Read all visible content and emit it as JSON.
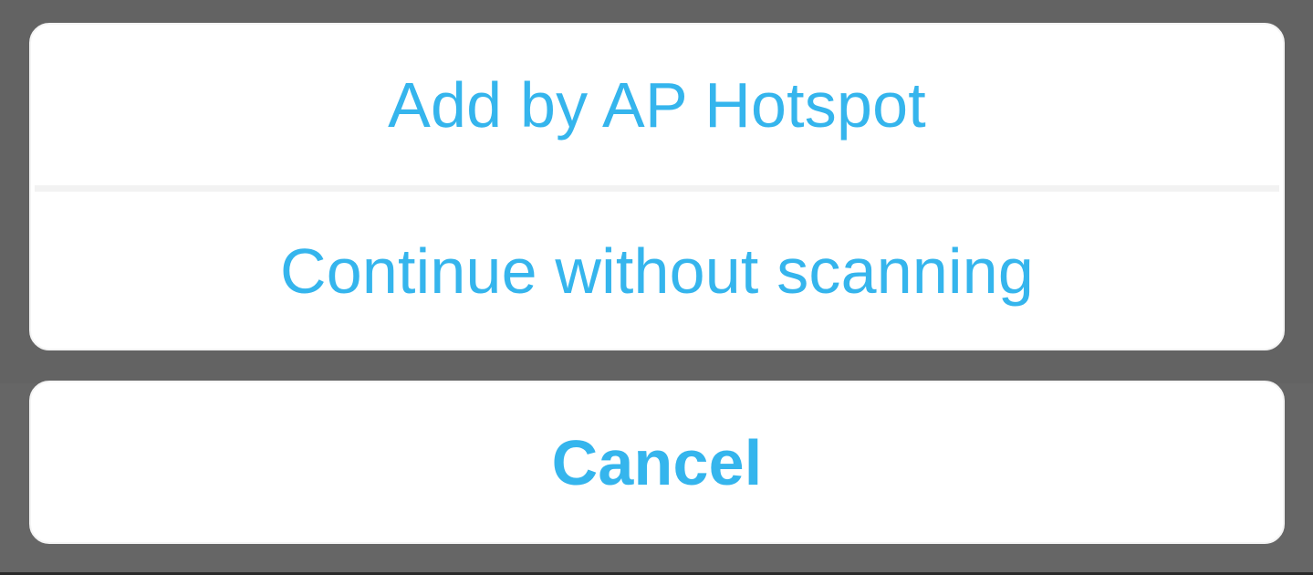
{
  "action_sheet": {
    "options": [
      {
        "label": "Add by AP Hotspot"
      },
      {
        "label": "Continue without scanning"
      }
    ],
    "cancel_label": "Cancel"
  },
  "colors": {
    "backdrop": "#646464",
    "sheet_background": "#ffffff",
    "action_text": "#35b5ed",
    "divider": "#f2f2f2"
  }
}
